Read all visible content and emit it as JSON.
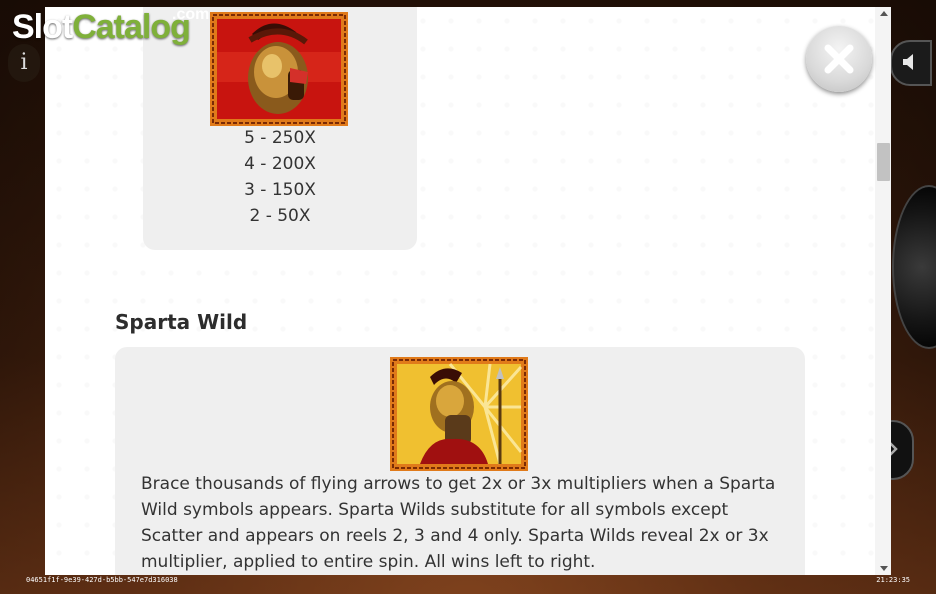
{
  "logo": {
    "slot": "Slot",
    "catalog": "Catalog",
    "dotcom": ".com"
  },
  "info_button": {
    "glyph": "i"
  },
  "paytable": {
    "symbol_payouts": [
      "5 - 250X",
      "4 - 200X",
      "3 - 150X",
      "2 - 50X"
    ],
    "wild_section": {
      "title": "Sparta Wild",
      "description": "Brace thousands of flying arrows to get 2x or 3x multipliers when a Sparta Wild symbols appears. Sparta Wilds substitute for all symbols except Scatter and appears on reels 2, 3 and 4 only. Sparta Wilds reveal 2x or 3x multiplier, applied to entire spin. All wins left to right."
    }
  },
  "footer": {
    "session_id": "04651f1f-9e39-427d-b5bb-547e7d316038",
    "time": "21:23:35"
  },
  "colors": {
    "logo_green": "#7fb03a",
    "panel_card": "#efefef",
    "helmet_background": "#c8140f",
    "greek_border": "#e07a1a"
  },
  "icons": {
    "close": "close-icon",
    "sound": "speaker-icon",
    "next": "chevron-right-icon",
    "info": "info-icon"
  }
}
